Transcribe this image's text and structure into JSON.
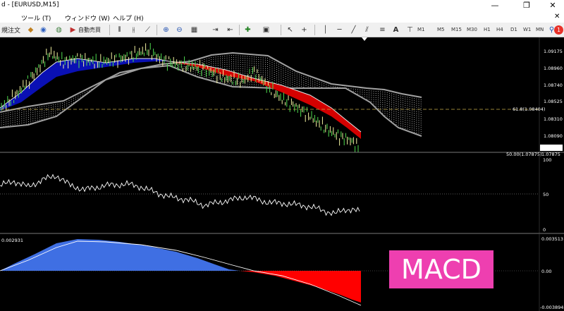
{
  "window": {
    "title": "d - [EURUSD,M15]",
    "minimize_glyph": "—",
    "restore_glyph": "❐",
    "close_glyph": "✕"
  },
  "menu": {
    "tools": "ツール (T)",
    "window": "ウィンドウ (W)",
    "help": "ヘルプ (H)",
    "close_glyph": "✕"
  },
  "toolbar": {
    "new_order": "規注文",
    "autotrade": "自動売買",
    "text_tool": "A",
    "notification_badge": "1",
    "timeframes": [
      "M1",
      "M5",
      "M15",
      "M30",
      "H1",
      "H4",
      "D1",
      "W1",
      "MN"
    ]
  },
  "price_panel": {
    "levels": [
      "1.09175",
      "1.08960",
      "1.08740",
      "1.08525",
      "1.08310",
      "1.08090"
    ],
    "current_price": "1.07933",
    "bottom_label": "1.07875",
    "fib_text": "61.8(1.08404)",
    "fib_bottom_text": "50.00(1.07875)"
  },
  "rsi_panel": {
    "levels": [
      "100",
      "50",
      "0"
    ]
  },
  "macd_panel": {
    "value_text": "0.002931",
    "levels": [
      "0.003513",
      "0.00",
      "-0.003894"
    ]
  },
  "overlay": {
    "label": "MACD"
  },
  "colors": {
    "bull_cloud": "#0a10b4",
    "bear_cloud": "#d40000",
    "macd_pos": "#3f6fe3",
    "macd_neg": "#ff0000",
    "badge": "#e8322a",
    "overlay": "#ee3fb0"
  }
}
